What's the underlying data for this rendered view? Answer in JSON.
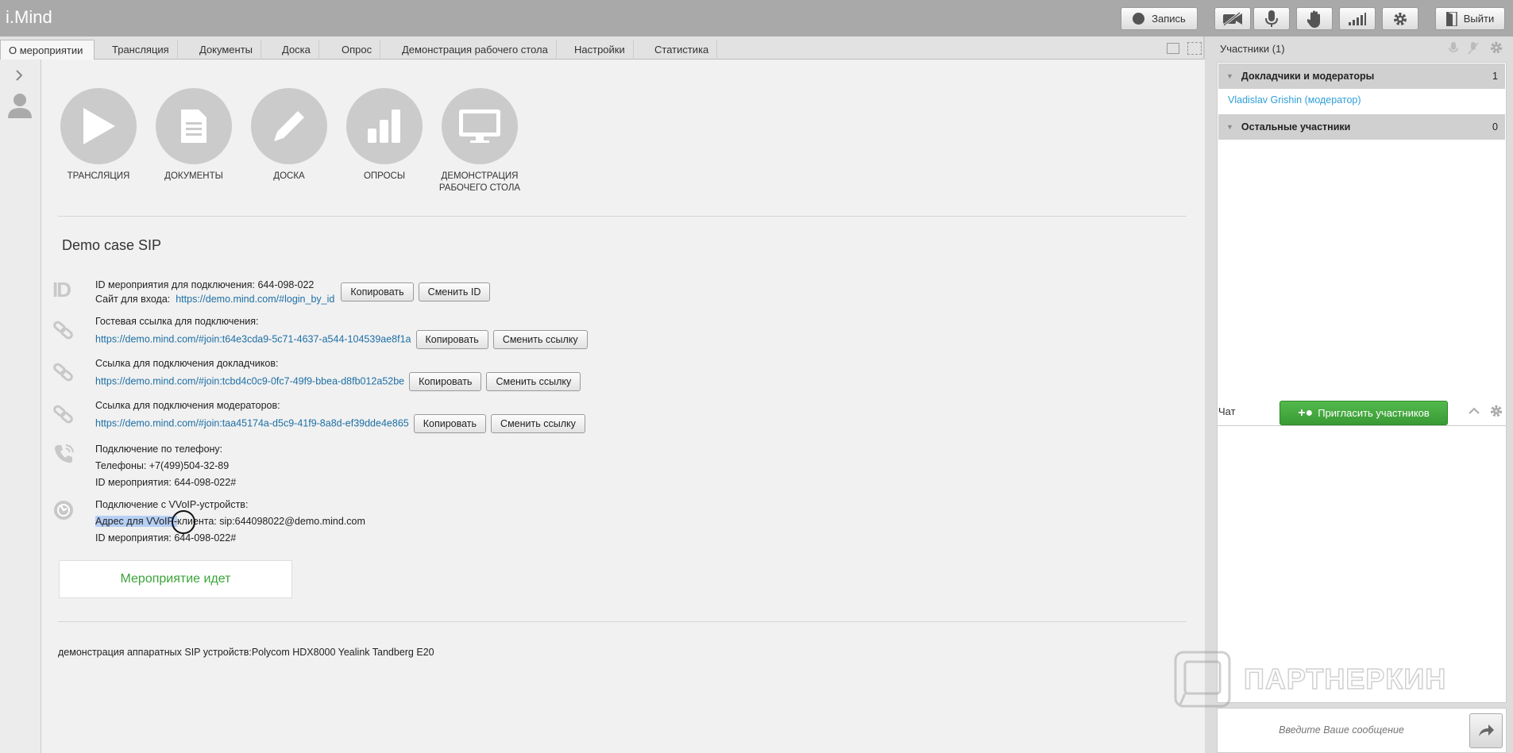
{
  "app": {
    "title": "i.Mind"
  },
  "toolbar": {
    "record_label": "Запись",
    "exit_label": "Выйти"
  },
  "tabs": [
    {
      "label": "О мероприятии",
      "active": true
    },
    {
      "label": "Трансляция"
    },
    {
      "label": "Документы"
    },
    {
      "label": "Доска"
    },
    {
      "label": "Опрос"
    },
    {
      "label": "Демонстрация рабочего стола"
    },
    {
      "label": "Настройки"
    },
    {
      "label": "Статистика"
    }
  ],
  "features": [
    {
      "label": "ТРАНСЛЯЦИЯ",
      "icon": "play-icon"
    },
    {
      "label": "ДОКУМЕНТЫ",
      "icon": "document-icon"
    },
    {
      "label": "ДОСКА",
      "icon": "pencil-icon"
    },
    {
      "label": "ОПРОСЫ",
      "icon": "bars-icon"
    },
    {
      "label": "ДЕМОНСТРАЦИЯ РАБОЧЕГО СТОЛА",
      "icon": "monitor-icon"
    }
  ],
  "event": {
    "title": "Demo case SIP",
    "id": {
      "text": "ID мероприятия для подключения: 644-098-022",
      "site_label": "Сайт для входа:",
      "site_link": "https://demo.mind.com/#login_by_id",
      "copy": "Копировать",
      "change": "Сменить ID",
      "icon_text": "ID"
    },
    "guest": {
      "label": "Гостевая ссылка для подключения:",
      "link": "https://demo.mind.com/#join:t64e3cda9-5c71-4637-a544-104539ae8f1a",
      "copy": "Копировать",
      "change": "Сменить ссылку"
    },
    "speakers": {
      "label": "Ссылка для подключения докладчиков:",
      "link": "https://demo.mind.com/#join:tcbd4c0c9-0fc7-49f9-bbea-d8fb012a52be",
      "copy": "Копировать",
      "change": "Сменить ссылку"
    },
    "moderators": {
      "label": "Ссылка для подключения модераторов:",
      "link": "https://demo.mind.com/#join:taa45174a-d5c9-41f9-8a8d-ef39dde4e865",
      "copy": "Копировать",
      "change": "Сменить ссылку"
    },
    "phone": {
      "label": "Подключение по телефону:",
      "phones": "Телефоны: +7(499)504-32-89",
      "id": "ID мероприятия: 644-098-022#"
    },
    "voip": {
      "label": "Подключение с VVoIP-устройств:",
      "address_selected": "Адрес для VVoIP-",
      "address_rest": "клиента: sip:644098022@demo.mind.com",
      "id": "ID мероприятия: 644-098-022#"
    },
    "status": "Мероприятие идет",
    "note": "демонстрация аппаратных SIP устройств:Polycom HDX8000 Yealink Tandberg E20"
  },
  "participants": {
    "title": "Участники (1)",
    "groups": [
      {
        "name": "Докладчики и модераторы",
        "count": "1",
        "members": [
          "Vladislav Grishin (модератор)"
        ]
      },
      {
        "name": "Остальные участники",
        "count": "0",
        "members": []
      }
    ],
    "invite": "Пригласить участников"
  },
  "chat": {
    "title": "Чат",
    "placeholder": "Введите Ваше сообщение"
  },
  "watermark": "ПАРТНЕРКИН",
  "colors": {
    "accent_green": "#3aa33a",
    "link": "#1d6fa5",
    "participant": "#2f9fd8"
  }
}
